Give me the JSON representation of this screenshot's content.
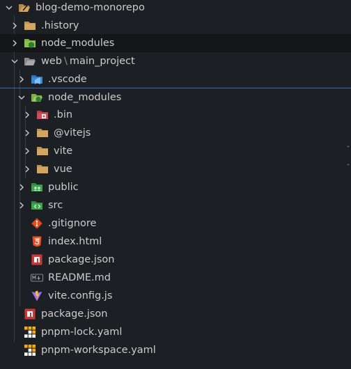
{
  "explorer": {
    "root": {
      "label": "blog-demo-monorepo",
      "expanded": true
    },
    "items": [
      {
        "label": ".history",
        "kind": "folder",
        "icon": "folder-icon",
        "depth": 1,
        "expanded": false
      },
      {
        "label": "node_modules",
        "kind": "folder",
        "icon": "node-modules-folder-icon",
        "depth": 1,
        "expanded": false
      },
      {
        "label": "web",
        "label2": "main_project",
        "kind": "folder",
        "icon": "folder-open-icon",
        "depth": 1,
        "expanded": true
      },
      {
        "label": ".vscode",
        "kind": "folder",
        "icon": "vscode-folder-icon",
        "depth": 2,
        "expanded": false
      },
      {
        "label": "node_modules",
        "kind": "folder",
        "icon": "node-modules-open-icon",
        "depth": 2,
        "expanded": true
      },
      {
        "label": ".bin",
        "kind": "folder",
        "icon": "bin-folder-icon",
        "depth": 3,
        "expanded": false
      },
      {
        "label": "@vitejs",
        "kind": "folder",
        "icon": "folder-icon",
        "depth": 3,
        "expanded": false
      },
      {
        "label": "vite",
        "kind": "folder",
        "icon": "folder-icon",
        "depth": 3,
        "expanded": false
      },
      {
        "label": "vue",
        "kind": "folder",
        "icon": "folder-icon",
        "depth": 3,
        "expanded": false
      },
      {
        "label": "public",
        "kind": "folder",
        "icon": "public-folder-icon",
        "depth": 2,
        "expanded": false
      },
      {
        "label": "src",
        "kind": "folder",
        "icon": "src-folder-icon",
        "depth": 2,
        "expanded": false
      },
      {
        "label": ".gitignore",
        "kind": "file",
        "icon": "git-icon",
        "depth": 2
      },
      {
        "label": "index.html",
        "kind": "file",
        "icon": "html5-icon",
        "depth": 2
      },
      {
        "label": "package.json",
        "kind": "file",
        "icon": "npm-icon",
        "depth": 2
      },
      {
        "label": "README.md",
        "kind": "file",
        "icon": "markdown-icon",
        "depth": 2
      },
      {
        "label": "vite.config.js",
        "kind": "file",
        "icon": "vite-icon",
        "depth": 2
      },
      {
        "label": "package.json",
        "kind": "file",
        "icon": "npm-icon",
        "depth": 1
      },
      {
        "label": "pnpm-lock.yaml",
        "kind": "file",
        "icon": "pnpm-icon",
        "depth": 1
      },
      {
        "label": "pnpm-workspace.yaml",
        "kind": "file",
        "icon": "pnpm-icon",
        "depth": 1
      }
    ],
    "colors": {
      "background": "#1c1f24",
      "folder": "#c09553",
      "node_green": "#8bc34a",
      "selection_border": "#2f6db3"
    }
  }
}
